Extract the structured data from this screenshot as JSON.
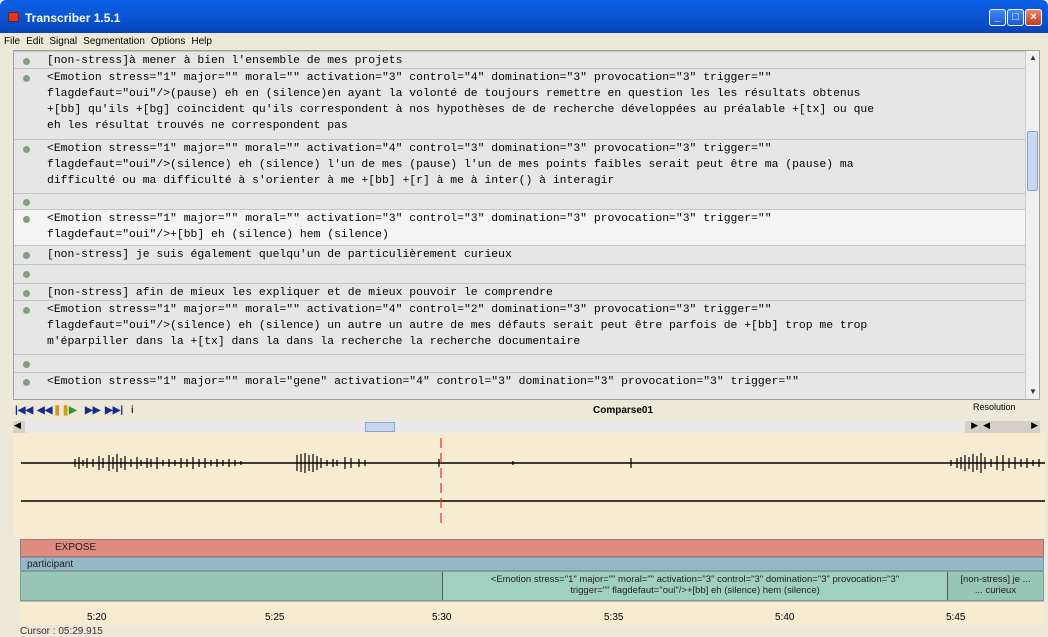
{
  "window": {
    "title": "Transcriber 1.5.1"
  },
  "menu": [
    "File",
    "Edit",
    "Signal",
    "Segmentation",
    "Options",
    "Help"
  ],
  "segments": [
    {
      "text": "[non-stress]à mener à bien l'ensemble de mes projets",
      "top": 0,
      "h": 14
    },
    {
      "text": "<Emotion stress=\"1\" major=\"\" moral=\"\" activation=\"3\" control=\"4\" domination=\"3\" provocation=\"3\" trigger=\"\"\nflagdefaut=\"oui\"/>(pause) eh en (silence)en ayant la volonté de toujours remettre en question les les résultats obtenus\n+[bb] qu'ils +[bg] coincident qu'ils correspondent à nos hypothèses de de recherche développées au préalable +[tx] ou que\neh les résultat trouvés ne correspondent pas"
    },
    {
      "text": "<Emotion stress=\"1\" major=\"\" moral=\"\" activation=\"4\" control=\"3\" domination=\"3\" provocation=\"3\" trigger=\"\"\nflagdefaut=\"oui\"/>(silence) eh (silence) l'un de mes (pause) l'un de mes points faibles serait peut être ma (pause) ma\ndifficulté ou ma difficulté à s'orienter à me +[bb] +[r] à me à inter() à interagir"
    },
    {
      "text": ""
    },
    {
      "text": "<Emotion stress=\"1\" major=\"\" moral=\"\" activation=\"3\" control=\"3\" domination=\"3\" provocation=\"3\" trigger=\"\"\nflagdefaut=\"oui\"/>+[bb] eh (silence) hem (silence)"
    },
    {
      "text": "[non-stress] je suis également quelqu'un de particulièrement curieux"
    },
    {
      "text": ""
    },
    {
      "text": "[non-stress] afin de mieux les expliquer et de mieux pouvoir le comprendre"
    },
    {
      "text": "<Emotion stress=\"1\" major=\"\" moral=\"\" activation=\"4\" control=\"2\" domination=\"3\" provocation=\"3\" trigger=\"\"\nflagdefaut=\"oui\"/>(silence) eh (silence) un autre un autre de mes défauts serait peut être parfois de +[bb] trop me trop\nm'éparpiller dans la +[tx] dans la dans la recherche la recherche documentaire"
    },
    {
      "text": ""
    },
    {
      "text": "<Emotion stress=\"1\" major=\"\" moral=\"gene\" activation=\"4\" control=\"3\" domination=\"3\" provocation=\"3\" trigger=\"\""
    }
  ],
  "signal": {
    "name": "Comparse01",
    "resolution_label": "Resolution"
  },
  "tiers": {
    "topic": "EXPOSE",
    "speaker": "participant",
    "segment_selected": "<Emotion stress=\"1\" major=\"\" moral=\"\" activation=\"3\" control=\"3\" domination=\"3\" provocation=\"3\"\ntrigger=\"\" flagdefaut=\"oui\"/>+[bb] eh (silence) hem (silence)",
    "segment_next": "[non-stress] je ...\n... curieux"
  },
  "axis_ticks": [
    "5:20",
    "5:25",
    "5:30",
    "5:35",
    "5:40",
    "5:45"
  ],
  "cursor": "Cursor : 05:29.915",
  "colors": {
    "titlebar": "#0a58d8",
    "topic_tier": "#df8b80",
    "speaker_tier": "#95b7c7",
    "segment_tier": "#98c6b6",
    "cursor_line": "#e03030"
  }
}
